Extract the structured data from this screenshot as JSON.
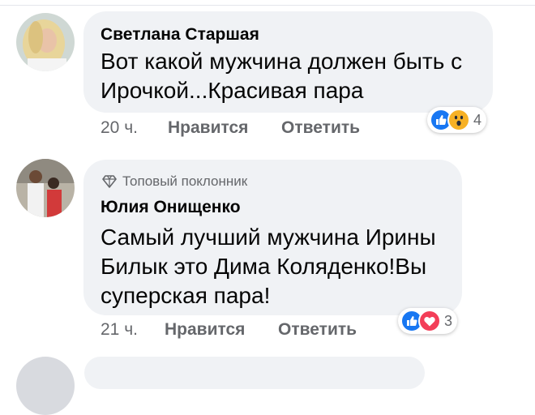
{
  "comments": [
    {
      "author": "Светлана Старшая",
      "text_lines": [
        "Вот какой мужчина должен быть с",
        "Ирочкой...Красивая пара"
      ],
      "time": "20 ч.",
      "like_label": "Нравится",
      "reply_label": "Ответить",
      "reaction_icons": [
        "like-icon",
        "wow-icon"
      ],
      "reaction_count": "4"
    },
    {
      "badge": "Топовый поклонник",
      "author": "Юлия Онищенко",
      "text_lines": [
        "Самый лучший мужчина Ирины",
        "Билык это Дима Коляденко!Вы",
        "суперская пара!"
      ],
      "time": "21 ч.",
      "like_label": "Нравится",
      "reply_label": "Ответить",
      "reaction_icons": [
        "like-icon",
        "love-icon"
      ],
      "reaction_count": "3"
    }
  ],
  "colors": {
    "bubble": "#f0f2f5",
    "meta_text": "#65676b",
    "like_blue": "#1877f2",
    "love_red": "#f33e58",
    "wow_yellow": "#f7b125"
  }
}
